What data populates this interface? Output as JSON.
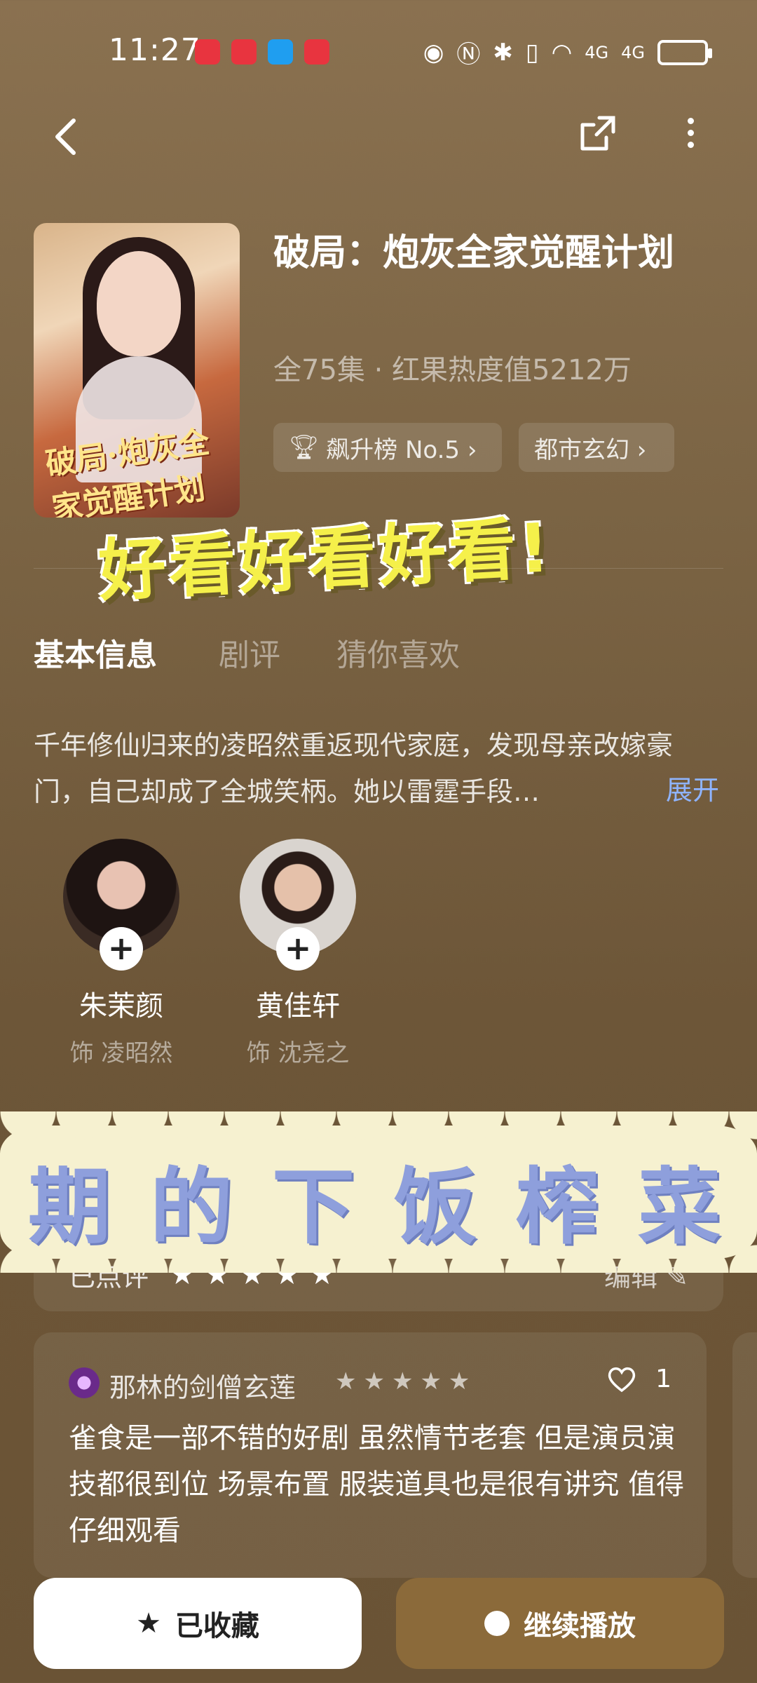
{
  "status_bar": {
    "time": "11:27",
    "network_1": "4G",
    "network_2": "4G"
  },
  "show": {
    "title": "破局：炮灰全家觉醒计划",
    "meta": "全75集 · 红果热度值5212万",
    "poster_title": "破局·炮灰全家觉醒计划",
    "tags": [
      {
        "label": "飙升榜 No.5 ›",
        "icon": "trophy-icon"
      },
      {
        "label": "都市玄幻 ›"
      }
    ]
  },
  "sticker_text": "好看好看好看!",
  "tabs": [
    "基本信息",
    "剧评",
    "猜你喜欢"
  ],
  "synopsis": {
    "text": "千年修仙归来的凌昭然重返现代家庭，发现母亲改嫁豪门，自己却成了全城笑柄。她以雷霆手段…",
    "expand_label": "展开"
  },
  "cast": [
    {
      "name": "朱茉颜",
      "role": "饰 凌昭然"
    },
    {
      "name": "黄佳轩",
      "role": "饰 沈尧之"
    }
  ],
  "banner_text": "期的下饭榨菜",
  "rating": {
    "label": "已点评",
    "stars": "★★★★★",
    "edit_label": "编辑"
  },
  "review": {
    "user": "那林的剑僧玄莲",
    "stars": "★★★★★",
    "likes": "1",
    "text": "雀食是一部不错的好剧 虽然情节老套 但是演员演技都很到位 场景布置 服装道具也是很有讲究 值得仔细观看"
  },
  "actions": {
    "favorite_label": "已收藏",
    "play_label": "继续播放"
  },
  "colors": {
    "accent_link": "#8fb4ff",
    "play_button": "#8b6a3a",
    "sticker_yellow": "#f5f04a",
    "banner_text": "#8e9fdc"
  }
}
